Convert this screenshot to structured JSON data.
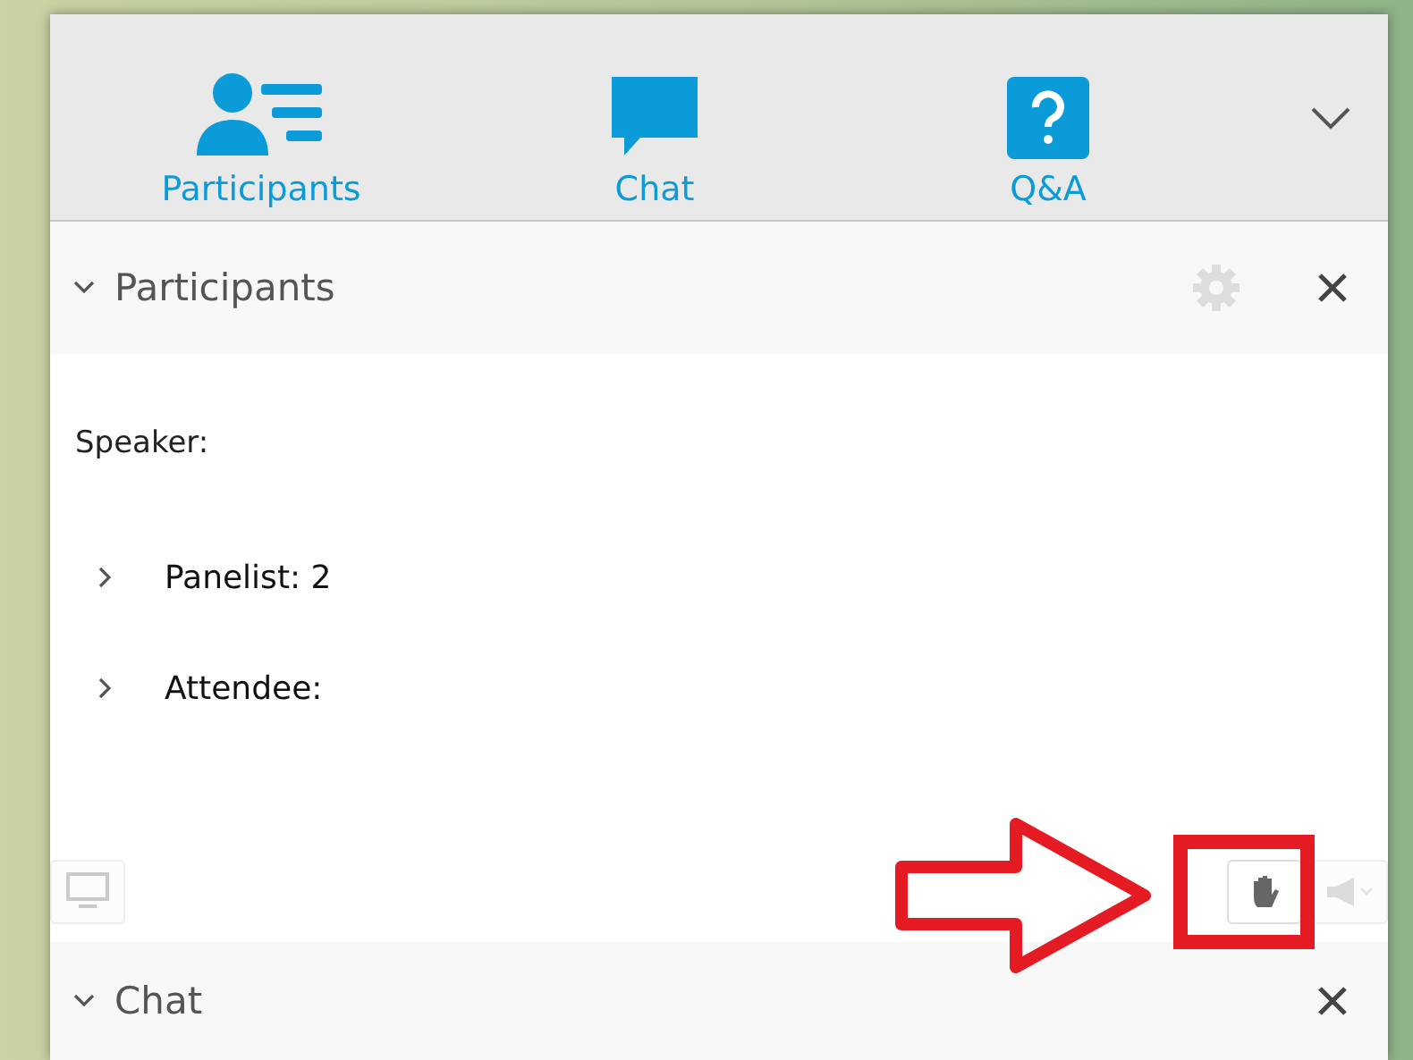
{
  "tabs": [
    {
      "kind": "participants",
      "label": "Participants"
    },
    {
      "kind": "chat",
      "label": "Chat"
    },
    {
      "kind": "qa",
      "label": "Q&A"
    }
  ],
  "participants_panel": {
    "title": "Participants",
    "expanded": true,
    "speaker_label": "Speaker:",
    "groups": [
      {
        "label": "Panelist: 2",
        "expanded": false
      },
      {
        "label": "Attendee:",
        "expanded": false
      }
    ]
  },
  "chat_panel": {
    "title": "Chat",
    "expanded": true
  }
}
